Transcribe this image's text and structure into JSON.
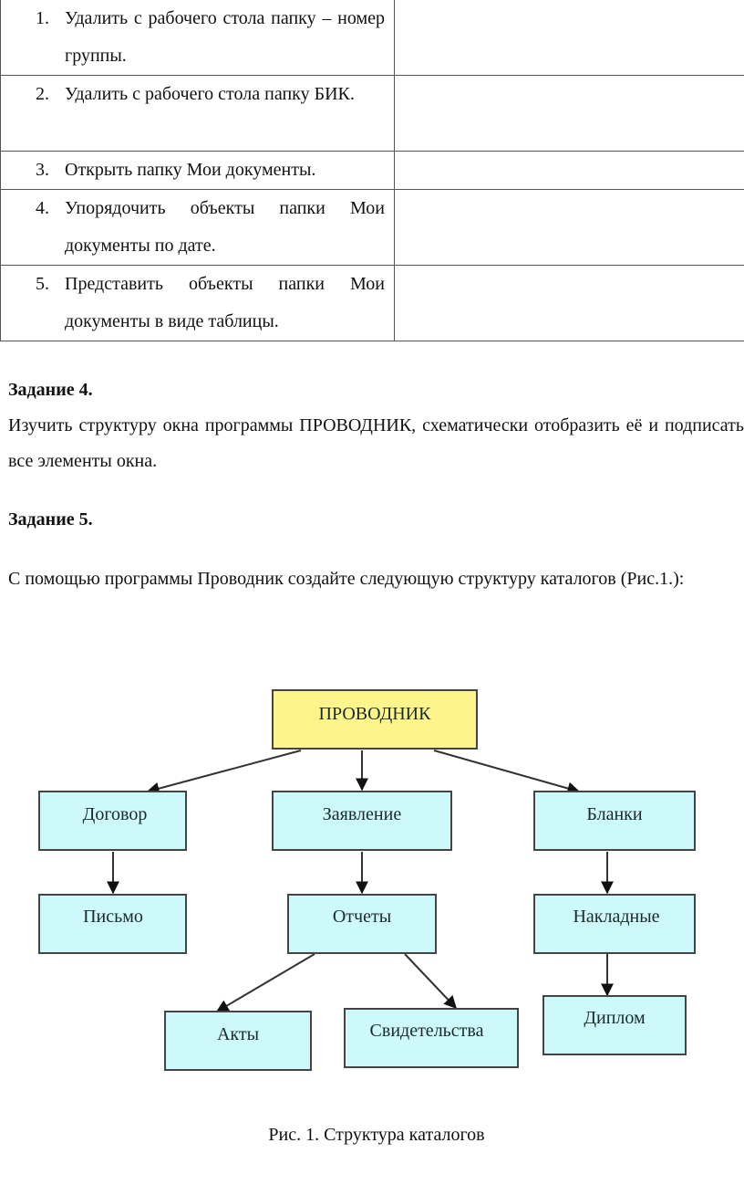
{
  "table": {
    "rows": [
      {
        "number": "1.",
        "text": "Удалить с рабочего стола папку – номер группы.",
        "answer": ""
      },
      {
        "number": "2.",
        "text": "Удалить с рабочего стола папку БИК.",
        "answer": ""
      },
      {
        "number": "3.",
        "text": "Открыть папку Мои документы.",
        "answer": ""
      },
      {
        "number": "4.",
        "text": "Упорядочить объекты папки Мои документы по дате.",
        "answer": ""
      },
      {
        "number": "5.",
        "text": "Представить объекты папки Мои документы в виде таблицы.",
        "answer": ""
      }
    ]
  },
  "task4": {
    "heading": "Задание 4.",
    "text": "Изучить структуру окна программы ПРОВОДНИК, схематически отобразить её и подписать все элементы окна."
  },
  "task5": {
    "heading": "Задание 5.",
    "text": "С помощью программы Проводник создайте следующую структуру каталогов (Рис.1.):"
  },
  "diagram": {
    "root": "ПРОВОДНИК",
    "level1": [
      "Договор",
      "Заявление",
      "Бланки"
    ],
    "level2": [
      "Письмо",
      "Отчеты",
      "Накладные"
    ],
    "level3": [
      "Акты",
      "Свидетельства",
      "Диплом"
    ],
    "colors": {
      "root_fill": "#fdf58c",
      "node_fill": "#cdf9fb",
      "border": "#444444"
    }
  },
  "caption": "Рис. 1. Структура каталогов"
}
